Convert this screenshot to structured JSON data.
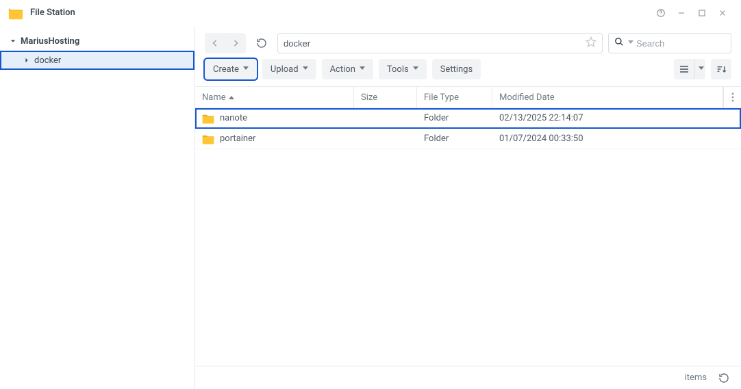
{
  "app": {
    "title": "File Station"
  },
  "sidebar": {
    "root_label": "MariusHosting",
    "items": [
      {
        "label": "docker",
        "selected": true
      }
    ]
  },
  "toolbar": {
    "path_value": "docker",
    "search_placeholder": "Search"
  },
  "actions": {
    "create_label": "Create",
    "upload_label": "Upload",
    "action_label": "Action",
    "tools_label": "Tools",
    "settings_label": "Settings"
  },
  "columns": {
    "name": "Name",
    "size": "Size",
    "type": "File Type",
    "date": "Modified Date"
  },
  "rows": [
    {
      "name": "nanote",
      "size": "",
      "type": "Folder",
      "date": "02/13/2025 22:14:07",
      "selected": true
    },
    {
      "name": "portainer",
      "size": "",
      "type": "Folder",
      "date": "01/07/2024 00:33:50",
      "selected": false
    }
  ],
  "status": {
    "items_label": "items"
  }
}
